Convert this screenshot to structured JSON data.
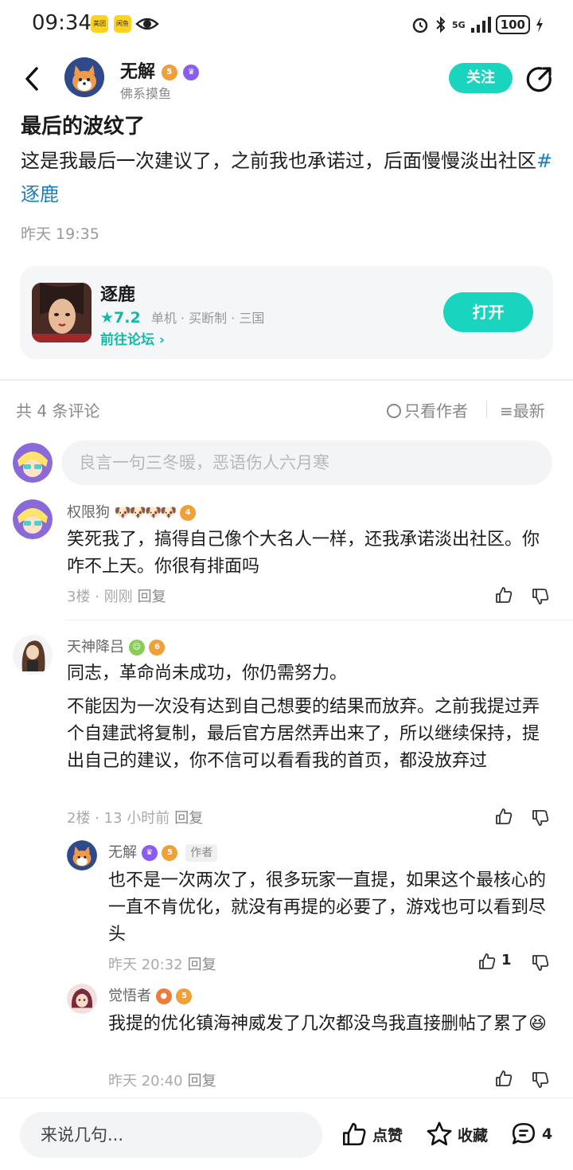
{
  "status_bar": {
    "time": "09:34",
    "app1": "美团",
    "app2": "闲鱼",
    "network": "5G",
    "battery": "100"
  },
  "header": {
    "author_name": "无解",
    "author_badge_level": "5",
    "author_signature": "佛系摸鱼",
    "follow_label": "关注"
  },
  "post": {
    "title": "最后的波纹了",
    "body": "这是我最后一次建议了，之前我也承诺过，后面慢慢淡出社区",
    "hashtag": "#逐鹿",
    "time": "昨天 19:35"
  },
  "game_card": {
    "name": "逐鹿",
    "rating": "7.2",
    "tags": "单机 · 买断制 · 三国",
    "forum_link": "前往论坛",
    "open_label": "打开"
  },
  "comments_header": {
    "count_label": "共 4 条评论",
    "only_author_label": "只看作者",
    "sort_label": "最新"
  },
  "comment_input": {
    "placeholder": "良言一句三冬暖，恶语伤人六月寒"
  },
  "comments": [
    {
      "name": "权限狗",
      "badge_level": "4",
      "text": "笑死我了，搞得自己像个大名人一样，还我承诺淡出社区。你咋不上天。你很有排面吗",
      "floor": "3楼",
      "time": "刚刚",
      "reply_label": "回复"
    },
    {
      "name": "天神降吕",
      "badge_level": "6",
      "text1": "同志，革命尚未成功，你仍需努力。",
      "text2": "不能因为一次没有达到自己想要的结果而放弃。之前我提过弄个自建武将复制，最后官方居然弄出来了，所以继续保持，提出自己的建议，你不信可以看看我的首页，都没放弃过",
      "floor": "2楼",
      "time": "13 小时前",
      "reply_label": "回复",
      "replies": [
        {
          "name": "无解",
          "badge_level": "5",
          "author_tag": "作者",
          "text": "也不是一次两次了，很多玩家一直提，如果这个最核心的一直不肯优化，就没有再提的必要了，游戏也可以看到尽头",
          "time": "昨天 20:32",
          "reply_label": "回复",
          "likes": "1"
        },
        {
          "name": "觉悟者",
          "badge_level": "5",
          "text": "我提的优化镇海神威发了几次都没鸟我直接删帖了累了",
          "emoji": "😆",
          "time": "昨天 20:40",
          "reply_label": "回复"
        }
      ]
    }
  ],
  "bottom_bar": {
    "input_placeholder": "来说几句...",
    "like_label": "点赞",
    "fav_label": "收藏",
    "comment_count": "4"
  },
  "colors": {
    "accent": "#19d5bf",
    "hashtag": "#1a7fb8",
    "badge_gold": "#f0a038",
    "badge_purple": "#8a5cf0"
  }
}
